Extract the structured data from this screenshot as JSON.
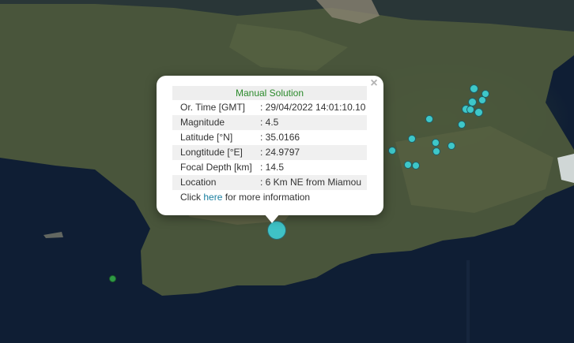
{
  "popup": {
    "title": "Manual Solution",
    "close_label": "×",
    "rows": [
      {
        "label": "Or. Time [GMT]",
        "value": ": 29/04/2022 14:01:10.10"
      },
      {
        "label": "Magnitude",
        "value": ": 4.5"
      },
      {
        "label": "Latitude [°N]",
        "value": ": 35.0166"
      },
      {
        "label": "Longtitude [°E]",
        "value": ": 24.9797"
      },
      {
        "label": "Focal Depth [km]",
        "value": ": 14.5"
      },
      {
        "label": "Location",
        "value": ": 6 Km NE from Miamou"
      }
    ],
    "more_prefix": "Click ",
    "more_link": "here",
    "more_suffix": " for more information"
  },
  "colors": {
    "sea": "#0f1e34",
    "land": "#4e5a3c",
    "event_marker": "#3ec7c9",
    "old_event_marker": "#2e9a44",
    "title_green": "#2b8a2b",
    "link": "#1a7fa0"
  }
}
